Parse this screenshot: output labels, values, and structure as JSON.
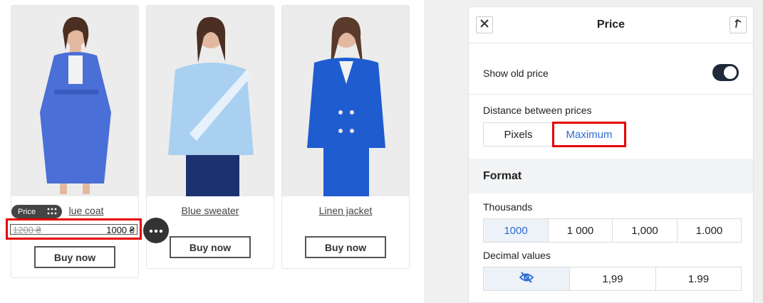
{
  "products": [
    {
      "name": "Blue coat",
      "visible_name": "lue coat",
      "old_price": "1200 ₴",
      "price": "1000 ₴",
      "buy_label": "Buy now",
      "coat_color": "#4a6fd6"
    },
    {
      "name": "Blue sweater",
      "buy_label": "Buy now",
      "coat_color": "#a9d0f0"
    },
    {
      "name": "Linen jacket",
      "buy_label": "Buy now",
      "coat_color": "#1f5cd0"
    }
  ],
  "selection": {
    "tag_label": "Price",
    "drag_icon": "drag-handle-icon",
    "more_icon": "more-dots-icon"
  },
  "panel": {
    "title": "Price",
    "close_icon": "close-icon",
    "pin_icon": "undock-icon",
    "show_old_price_label": "Show old price",
    "show_old_price_on": true,
    "distance_label": "Distance between prices",
    "distance_options": [
      "Pixels",
      "Maximum"
    ],
    "distance_selected": "Maximum",
    "format_title": "Format",
    "thousands_label": "Thousands",
    "thousands_options": [
      "1000",
      "1 000",
      "1,000",
      "1.000"
    ],
    "thousands_selected": "1000",
    "decimal_label": "Decimal values",
    "decimal_hidden_icon": "eye-off-icon",
    "decimal_options": [
      "1,99",
      "1.99"
    ]
  },
  "colors": {
    "accent": "#2d6bd1",
    "highlight": "#e60000",
    "toggle": "#1e2a3a"
  }
}
